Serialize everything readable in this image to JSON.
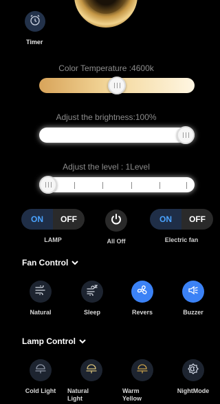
{
  "timer": {
    "label": "Timer",
    "icon": "alarm-clock-icon"
  },
  "sliders": {
    "color_temperature": {
      "title": "Color Temperature :4600k",
      "position_fraction": 0.5
    },
    "brightness": {
      "title": "Adjust the brightness:100%",
      "position_fraction": 1.0
    },
    "level": {
      "title": "Adjust the level : 1Level",
      "position_fraction": 0.0
    }
  },
  "controls": {
    "lamp": {
      "on": "ON",
      "off": "OFF",
      "label": "LAMP"
    },
    "all_off": {
      "label": "All Off",
      "icon": "power-icon"
    },
    "electric_fan": {
      "on": "ON",
      "off": "OFF",
      "label": "Electric fan"
    }
  },
  "fan_control": {
    "title": "Fan Control",
    "items": [
      {
        "label": "Natural",
        "icon": "wind-icon",
        "active": false
      },
      {
        "label": "Sleep",
        "icon": "sleep-wind-icon",
        "active": false
      },
      {
        "label": "Revers",
        "icon": "fan-icon",
        "active": true
      },
      {
        "label": "Buzzer",
        "icon": "speaker-icon",
        "active": true
      }
    ]
  },
  "lamp_control": {
    "title": "Lamp Control",
    "items": [
      {
        "label": "Cold Light",
        "icon": "lamp-icon"
      },
      {
        "label": "Natural Light",
        "icon": "lamp-icon"
      },
      {
        "label": "Warm Yellow",
        "icon": "lamp-icon"
      },
      {
        "label": "NightMode",
        "icon": "night-mode-icon"
      }
    ]
  },
  "colors": {
    "accent_blue": "#3b82f6",
    "on_text": "#4aa3ff",
    "warm": "#d8a45a"
  }
}
